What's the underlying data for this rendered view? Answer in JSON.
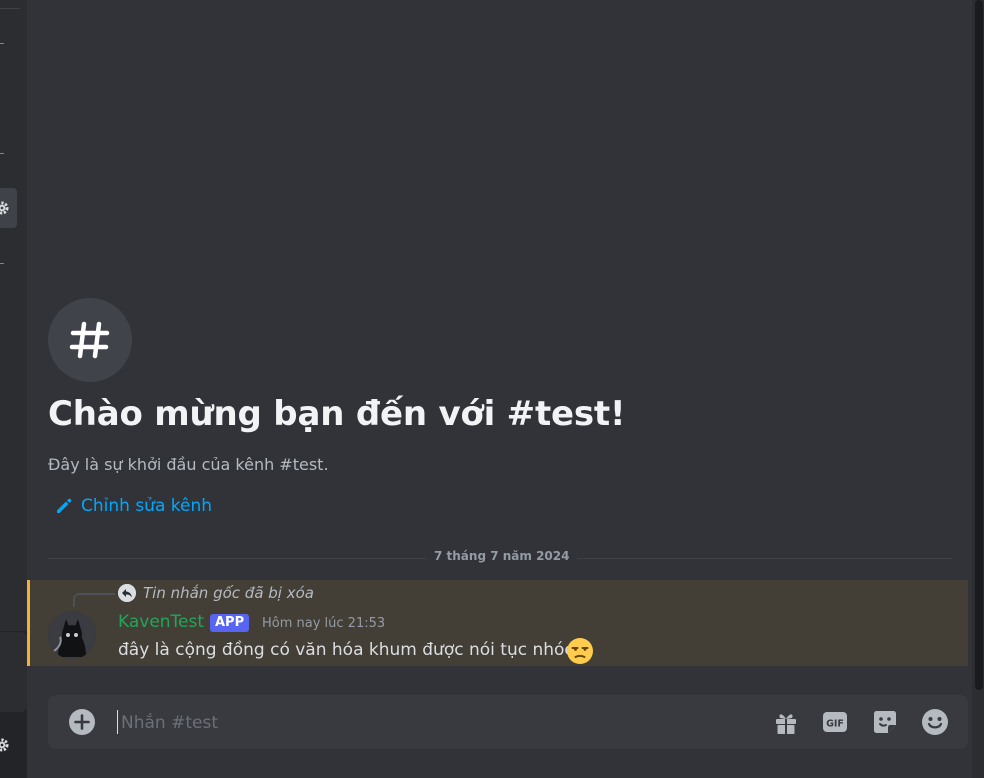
{
  "channel": {
    "welcome_title": "Chào mừng bạn đến với #test!",
    "welcome_subtitle": "Đây là sự khởi đầu của kênh #test.",
    "edit_label": "Chỉnh sửa kênh"
  },
  "divider": {
    "date": "7 tháng 7 năm 2024"
  },
  "message": {
    "reply_text": "Tin nhắn gốc đã bị xóa",
    "author": "KavenTest",
    "badge": "APP",
    "timestamp": "Hôm nay lúc 21:53",
    "content": "đây là cộng đồng có văn hóa khum được nói tục nhóe",
    "highlight_color": "#f0b232",
    "author_color": "#23a559"
  },
  "composer": {
    "placeholder": "Nhắn #test",
    "gif_label": "GIF"
  },
  "icons": {
    "channel": "hash-icon",
    "edit": "pencil-icon",
    "reply": "reply-icon",
    "emoji_in_message": "unamused-face-emoji",
    "attach": "plus-circle-icon",
    "gift": "gift-icon",
    "gif": "gif-icon",
    "sticker": "sticker-icon",
    "emoji_picker": "smile-icon",
    "settings": "gear-icon"
  },
  "colors": {
    "background": "#313338",
    "link": "#00a8fc",
    "accent": "#5865f2"
  }
}
